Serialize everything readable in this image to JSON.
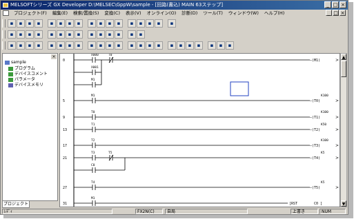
{
  "window": {
    "title": "MELSOFTシリーズ GX Developer D:\\MELSEC\\GppW\\sample - [回路(書込) MAIN 63ステップ]",
    "minimize": "_",
    "maximize": "□",
    "close": "×"
  },
  "menu": [
    "プロジェクト(F)",
    "編集(E)",
    "検索/置換(S)",
    "変換(C)",
    "表示(V)",
    "オンライン(O)",
    "診断(D)",
    "ツール(T)",
    "ウィンドウ(W)",
    "ヘルプ(H)"
  ],
  "toolbar_icons": {
    "row1": [
      "new-icon",
      "open-icon",
      "save-icon",
      "print-icon",
      "cut-icon",
      "copy-icon",
      "paste-icon",
      "undo-icon",
      "find-icon",
      "device-icon",
      "ladder-icon",
      "list-icon",
      "monitor-icon",
      "write-icon",
      "read-icon",
      "compare-icon",
      "verify-icon"
    ],
    "row2": [
      "contact-no-icon",
      "contact-nc-icon",
      "parallel-no-icon",
      "parallel-nc-icon",
      "coil-icon",
      "app-instruction-icon",
      "hline-icon",
      "vline-icon",
      "delete-line-icon",
      "rising-icon",
      "falling-icon",
      "convert-icon",
      "grid-icon",
      "comment-icon"
    ],
    "row3": [
      "f5-icon",
      "sf5-icon",
      "f6-icon",
      "sf6-icon",
      "f7-icon",
      "f8-icon",
      "f9-icon",
      "sf9-icon",
      "cf9-icon",
      "cf10-icon",
      "sf7-icon",
      "sf8-icon",
      "af7-icon",
      "af8-icon",
      "saf5-icon",
      "caf5-icon",
      "saf7-icon",
      "saf8-icon",
      "af5-icon",
      "caf10-icon",
      "f10-icon",
      "af9-icon",
      "bar-icon"
    ]
  },
  "project_panel": {
    "root": "sample",
    "items": [
      "プログラム",
      "デバイスコメント",
      "パラメータ",
      "デバイスメモリ"
    ],
    "tab": "プロジェクト"
  },
  "ladder": {
    "rungs": [
      {
        "step": "0",
        "contacts": [
          "X000",
          "X001",
          "M1"
        ],
        "timer_contact": "T0",
        "coil": "M1"
      },
      {
        "step": "5",
        "contacts": [
          "M1"
        ],
        "coil": "T0",
        "coil_value": "K100"
      },
      {
        "step": "9",
        "contacts": [
          "T0"
        ],
        "coil": "T1",
        "coil_value": "K100"
      },
      {
        "step": "13",
        "contacts": [
          "T1"
        ],
        "coil": "T2",
        "coil_value": "K50"
      },
      {
        "step": "17",
        "contacts": [
          "T2"
        ],
        "coil": "T3",
        "coil_value": "K100"
      },
      {
        "step": "21",
        "contacts": [
          "T3",
          "C0"
        ],
        "nc_contact": "T5",
        "coil": "T4",
        "coil_value": "K5"
      },
      {
        "step": "27",
        "contacts": [
          "T4"
        ],
        "coil": "T5",
        "coil_value": "K5"
      },
      {
        "step": "31",
        "contacts": [
          "M1"
        ],
        "instruction": "RST",
        "operand": "C0"
      }
    ]
  },
  "status": {
    "ready": "ﾚﾃﾞｨ",
    "plc": "FX2N(C)",
    "station": "自局",
    "mode": "上書き",
    "num": "NUM"
  }
}
